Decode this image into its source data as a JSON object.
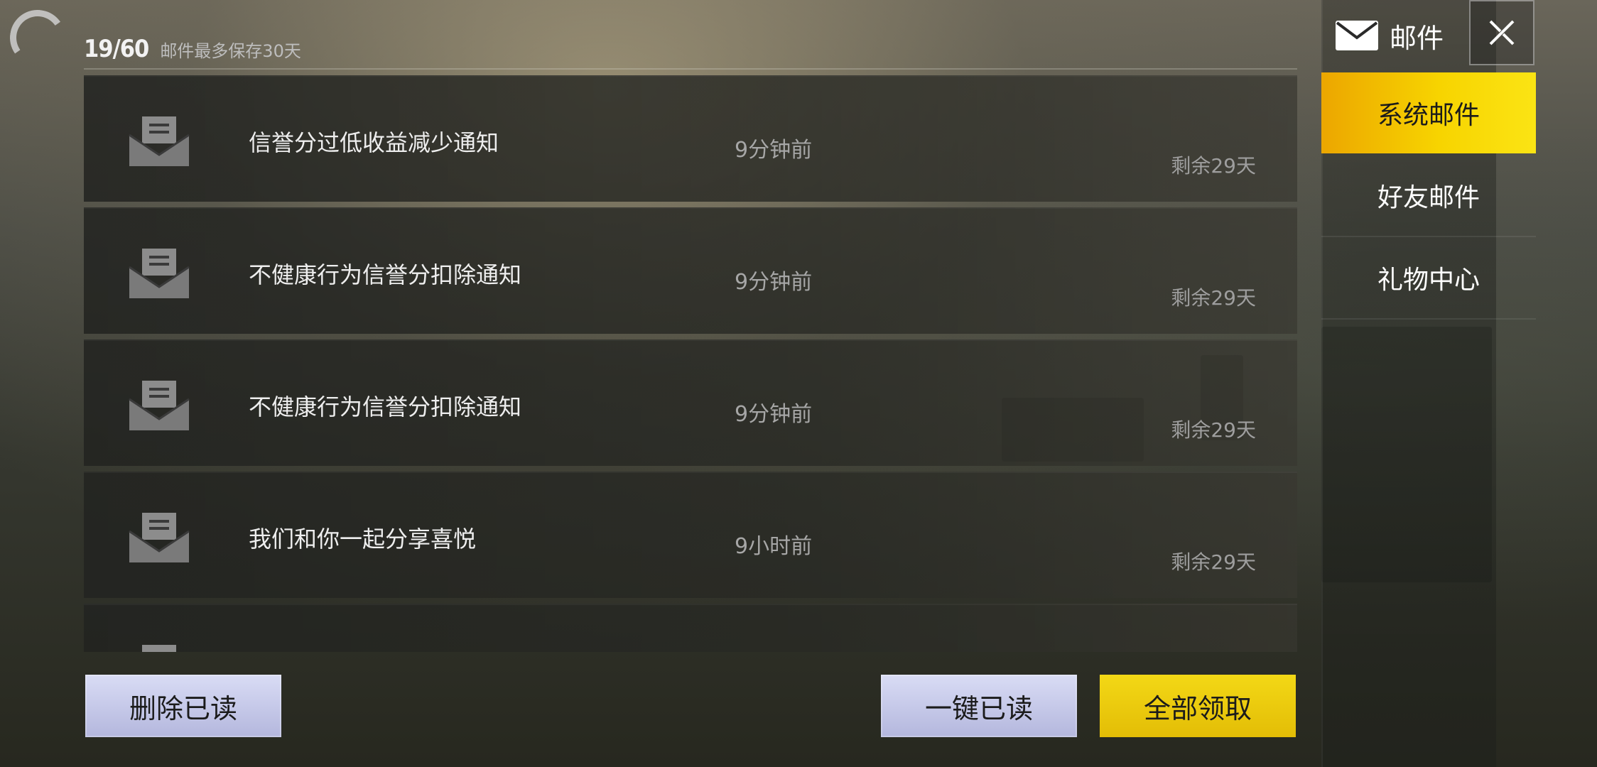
{
  "header": {
    "count": "19/60",
    "note": "邮件最多保存30天"
  },
  "panel": {
    "title": "邮件",
    "tabs": [
      {
        "label": "系统邮件",
        "active": true
      },
      {
        "label": "好友邮件",
        "active": false
      },
      {
        "label": "礼物中心",
        "active": false
      }
    ]
  },
  "mails": [
    {
      "title": "信誉分过低收益减少通知",
      "time": "9分钟前",
      "remaining": "剩余29天"
    },
    {
      "title": "不健康行为信誉分扣除通知",
      "time": "9分钟前",
      "remaining": "剩余29天"
    },
    {
      "title": "不健康行为信誉分扣除通知",
      "time": "9分钟前",
      "remaining": "剩余29天"
    },
    {
      "title": "我们和你一起分享喜悦",
      "time": "9小时前",
      "remaining": "剩余29天"
    },
    {
      "title": "",
      "time": "",
      "remaining": ""
    }
  ],
  "buttons": {
    "delete_read": "删除已读",
    "mark_all_read": "一键已读",
    "claim_all": "全部领取"
  },
  "colors": {
    "accent": "#f7d400",
    "button_lavender": "#c6c9ea"
  },
  "icons": {
    "back": "back-arc-icon",
    "mail_header": "envelope-icon",
    "close": "close-icon",
    "mail_row": "open-envelope-icon"
  }
}
